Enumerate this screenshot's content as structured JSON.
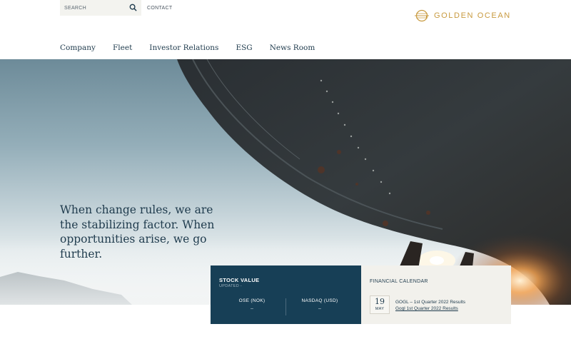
{
  "header": {
    "search_placeholder": "SEARCH",
    "contact_label": "CONTACT",
    "brand_name": "GOLDEN OCEAN",
    "brand_color": "#c89a3f"
  },
  "nav": {
    "items": [
      {
        "label": "Company"
      },
      {
        "label": "Fleet"
      },
      {
        "label": "Investor Relations"
      },
      {
        "label": "ESG"
      },
      {
        "label": "News Room"
      }
    ]
  },
  "hero": {
    "headline": "When change rules, we are the stabilizing factor. When opportunities arise, we go further."
  },
  "stock": {
    "title": "STOCK VALUE",
    "updated": "UPDATED -",
    "ose_label": "OSE (NOK)",
    "ose_value": "–",
    "nasdaq_label": "NASDAQ (USD)",
    "nasdaq_value": "–",
    "panel_color": "#173f56"
  },
  "calendar": {
    "title": "FINANCIAL CALENDAR",
    "day": "19",
    "month": "MAY",
    "event_text": "GOGL – 1st Quarter 2022 Results",
    "event_link": "Gogl 1st Quarter 2022 Results"
  },
  "icons": {
    "search": "search-icon",
    "logo": "golden-ocean-logo"
  }
}
